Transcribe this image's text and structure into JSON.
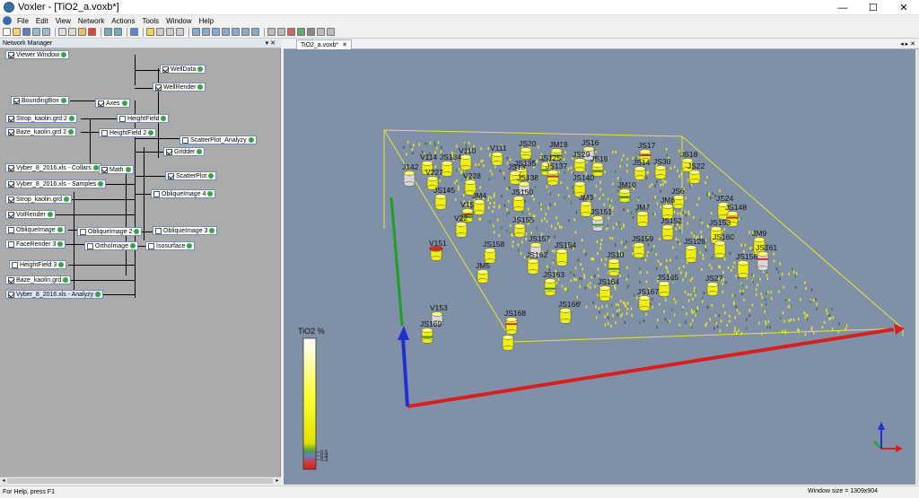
{
  "window": {
    "title": "Voxler - [TiO2_a.voxb*]",
    "controls": {
      "minimize": "—",
      "maximize": "☐",
      "close": "✕"
    }
  },
  "menu": [
    "File",
    "Edit",
    "View",
    "Network",
    "Actions",
    "Tools",
    "Window",
    "Help"
  ],
  "network_manager": {
    "title": "Network Manager",
    "pin": "▾ ✕",
    "nodes": [
      {
        "id": "viewer-window",
        "label": "Viewer Window",
        "checked": true
      },
      {
        "id": "welldata",
        "label": "WellData",
        "checked": true
      },
      {
        "id": "wellrender",
        "label": "WellRender",
        "checked": true
      },
      {
        "id": "boundingbox",
        "label": "BoundingBox",
        "checked": true
      },
      {
        "id": "axes",
        "label": "Axes",
        "checked": true
      },
      {
        "id": "strop-grd2",
        "label": "Strop_kaolin.grd 2",
        "checked": true
      },
      {
        "id": "heightfield",
        "label": "HeightField",
        "checked": false
      },
      {
        "id": "baze-grd2",
        "label": "Baze_kaolin.grd 2",
        "checked": true
      },
      {
        "id": "heightfield2",
        "label": "HeightField 2",
        "checked": false
      },
      {
        "id": "scatter-analyzy",
        "label": "ScatterPlot_Analyzy",
        "checked": false
      },
      {
        "id": "gridder",
        "label": "Gridder",
        "checked": true
      },
      {
        "id": "vyber-collars",
        "label": "Vyber_8_2016.xls - Collars",
        "checked": true
      },
      {
        "id": "math",
        "label": "Math",
        "checked": true
      },
      {
        "id": "scatterplot",
        "label": "ScatterPlot",
        "checked": true
      },
      {
        "id": "vyber-samples",
        "label": "Vyber_8_2016.xls - Samples",
        "checked": true
      },
      {
        "id": "obliqueimage4",
        "label": "ObliqueImage 4",
        "checked": false
      },
      {
        "id": "strop-grd",
        "label": "Strop_kaolin.grd",
        "checked": true
      },
      {
        "id": "volrender",
        "label": "VolRender",
        "checked": true
      },
      {
        "id": "obliqueimage",
        "label": "ObliqueImage",
        "checked": false
      },
      {
        "id": "obliqueimage2",
        "label": "ObliqueImage 2",
        "checked": false
      },
      {
        "id": "obliqueimage3",
        "label": "ObliqueImage 3",
        "checked": false
      },
      {
        "id": "facerender3",
        "label": "FaceRender 3",
        "checked": false
      },
      {
        "id": "orthoimage",
        "label": "OrthoImage",
        "checked": false
      },
      {
        "id": "isosurface",
        "label": "Isosurface",
        "checked": false
      },
      {
        "id": "heightfield3",
        "label": "HeightField 3",
        "checked": false
      },
      {
        "id": "baze-grd",
        "label": "Baze_kaolin.grd",
        "checked": true
      },
      {
        "id": "vyber-analyzy",
        "label": "Vyber_8_2016.xls - Analyzy",
        "checked": true
      }
    ]
  },
  "document_tab": {
    "label": "TiO2_a.voxb*",
    "close": "✕",
    "nav": "◂ ▸ ✕"
  },
  "viewer": {
    "colorbar": {
      "title": "TiO2 %",
      "labels": [
        "0.5",
        "0.4",
        "0.3"
      ]
    },
    "well_labels": [
      "V110",
      "V111",
      "JS20",
      "JM18",
      "JS16",
      "JS17",
      "JS18",
      "V114",
      "JS134",
      "JS135",
      "JS125",
      "JS29",
      "JS22",
      "J142",
      "V227",
      "JS13",
      "JS137",
      "JS19",
      "JS14",
      "JS30",
      "V228",
      "JS145",
      "JS138",
      "JS140",
      "JM10",
      "JS6",
      "JS24",
      "JS148",
      "JM4",
      "JS150",
      "JM3",
      "JS151",
      "JM7",
      "JM6",
      "JS152",
      "JS153",
      "JM9",
      "V22",
      "V15",
      "JS158",
      "JS157",
      "JS155",
      "V151",
      "JM5",
      "JS154",
      "JS10",
      "JS159",
      "JS128",
      "JS160",
      "JS161",
      "JS156",
      "JS162",
      "JS163",
      "JS164",
      "JS165",
      "JS27",
      "JS167",
      "JS166",
      "V153",
      "JS169",
      "JS168"
    ],
    "colors": {
      "background": "#8090a7",
      "bbox": "#e6e638",
      "axis_x": "#d62020",
      "axis_y": "#20a020",
      "axis_z": "#2030d0"
    }
  },
  "status": {
    "left": "For Help, press F1",
    "right": "Window size = 1309x904"
  }
}
